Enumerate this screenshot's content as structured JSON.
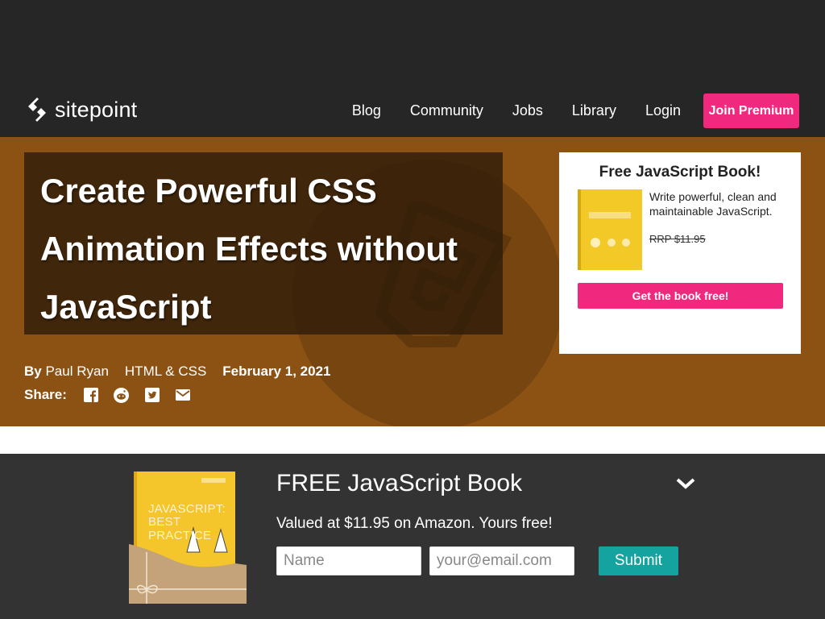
{
  "header": {
    "logo_text": "sitepoint",
    "nav": [
      {
        "label": "Blog"
      },
      {
        "label": "Community"
      },
      {
        "label": "Jobs"
      },
      {
        "label": "Library"
      },
      {
        "label": "Login"
      }
    ],
    "join_label": "Join Premium",
    "colors": {
      "bar": "#262627",
      "join": "#f0297f"
    }
  },
  "article": {
    "title": "Create Powerful CSS Animation Effects without JavaScript",
    "author_prefix": "By",
    "author": "Paul Ryan",
    "category": "HTML & CSS",
    "date": "February 1, 2021",
    "share_label": "Share:",
    "share_icons": [
      "facebook-icon",
      "reddit-icon",
      "twitter-icon",
      "email-icon"
    ],
    "hero_color": "#8b5214",
    "background_icon": "html5-shield-icon"
  },
  "promo": {
    "title": "Free JavaScript Book!",
    "description": "Write powerful, clean and maintainable JavaScript.",
    "rrp": "RRP $11.95",
    "button": "Get the book free!"
  },
  "footer_offer": {
    "heading": "FREE JavaScript Book",
    "subtext": "Valued at $11.95 on Amazon. Yours free!",
    "book_title_line1": "JAVASCRIPT:",
    "book_title_line2": "BEST PRACTICE",
    "name_placeholder": "Name",
    "email_placeholder": "your@email.com",
    "submit": "Submit",
    "colors": {
      "bg": "#333334",
      "submit": "#14a39e"
    }
  }
}
